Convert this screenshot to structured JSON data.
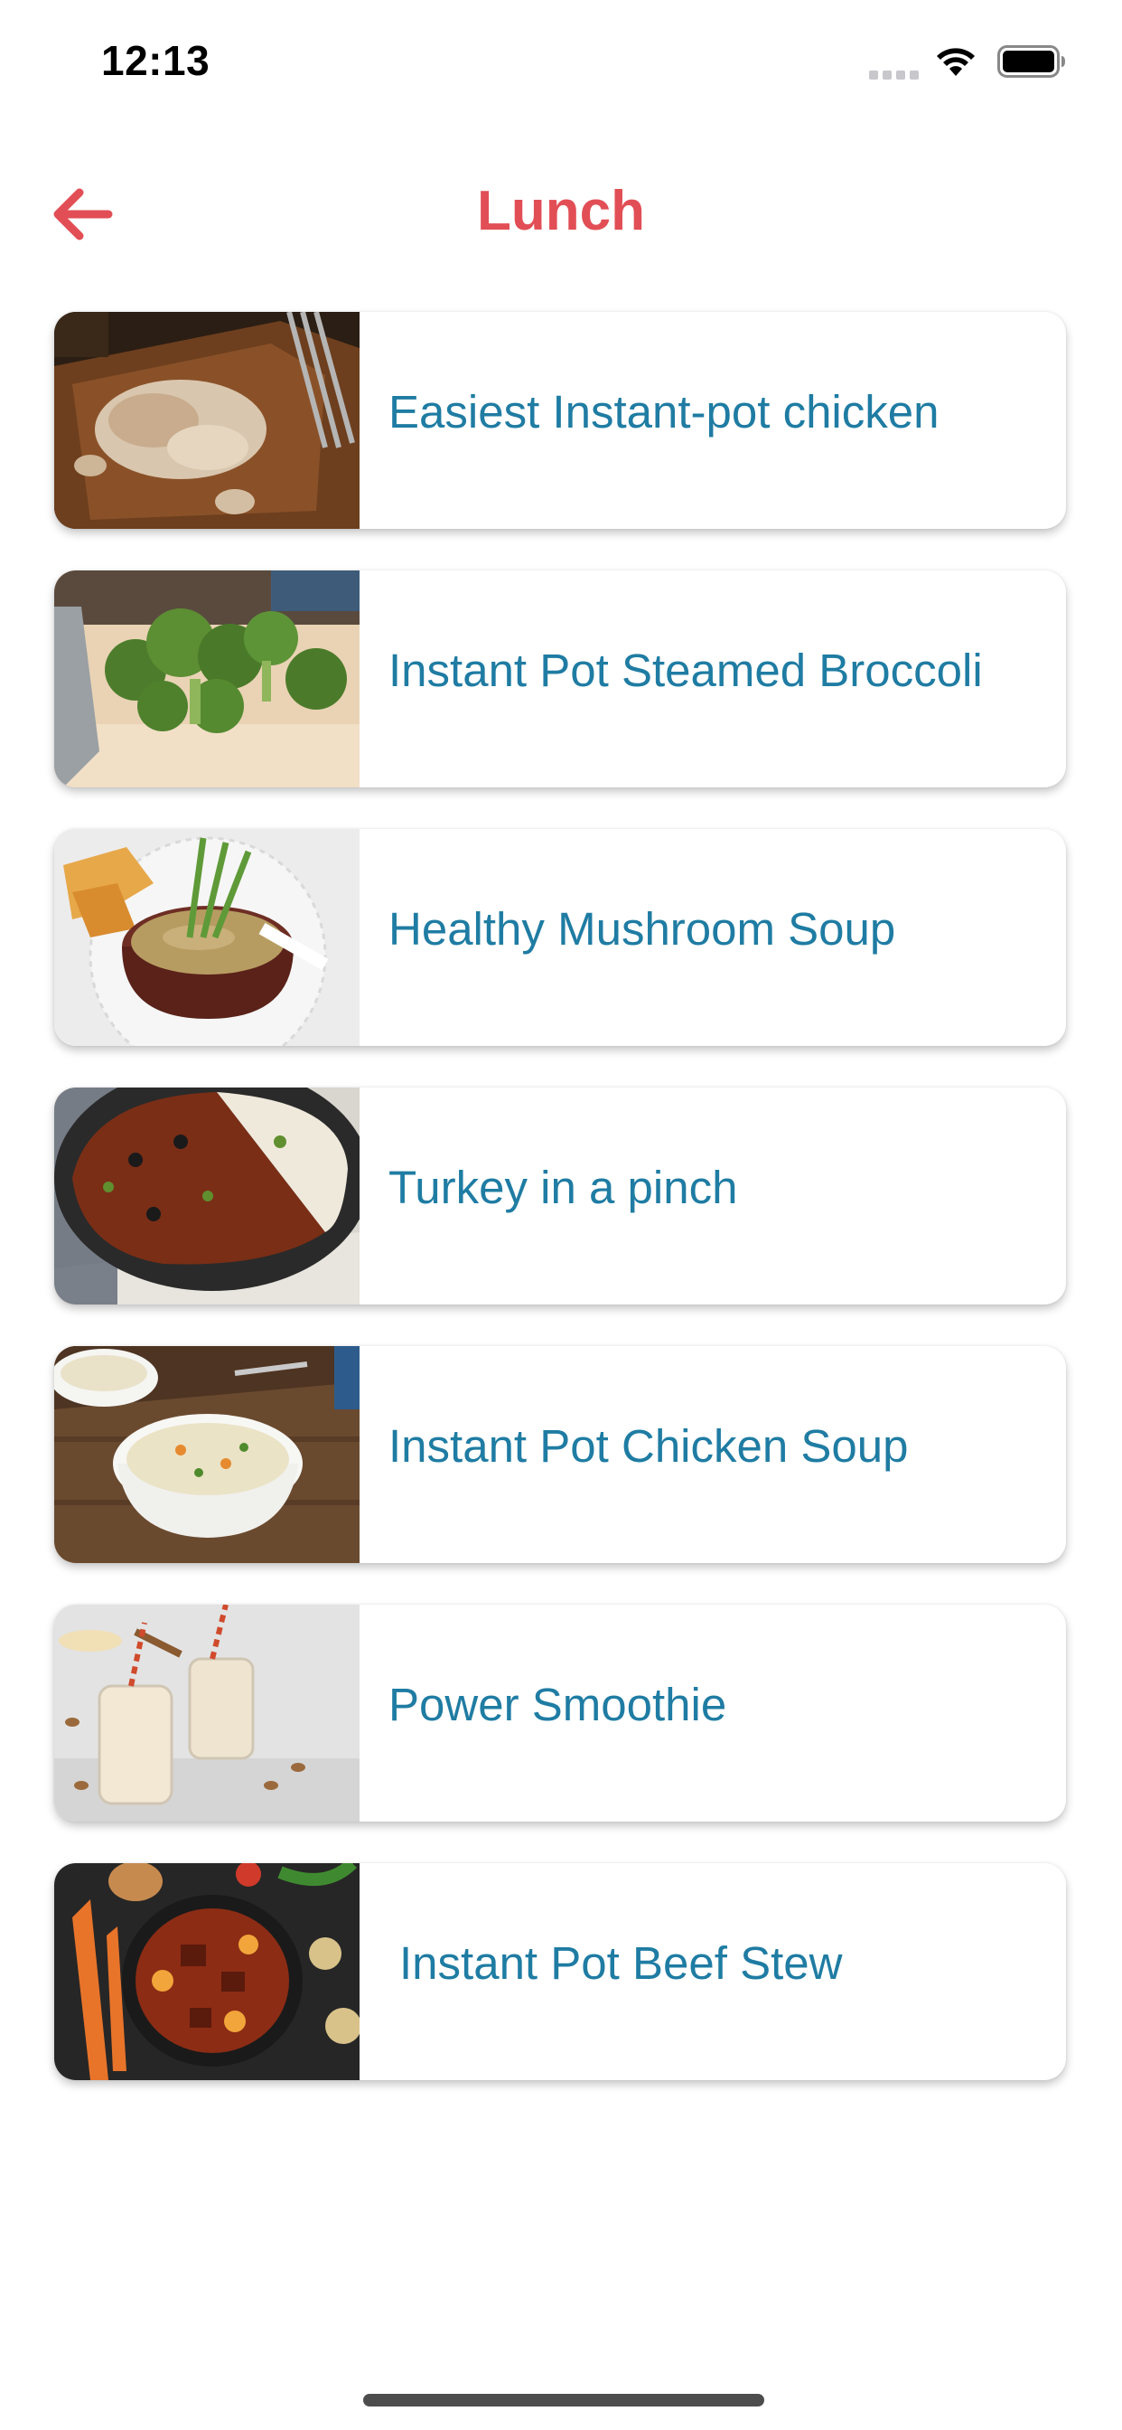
{
  "status_bar": {
    "time": "12:13"
  },
  "header": {
    "title": "Lunch",
    "back_icon": "arrow-left-icon"
  },
  "colors": {
    "accent": "#e24e55",
    "recipe_text": "#1f7ca3"
  },
  "recipes": [
    {
      "name": "Easiest Instant-pot chicken",
      "image": "shredded-chicken-on-board"
    },
    {
      "name": "Instant Pot Steamed Broccoli",
      "image": "broccoli-florets"
    },
    {
      "name": "Healthy Mushroom Soup",
      "image": "soup-in-bowl"
    },
    {
      "name": "Turkey in a pinch",
      "image": "ground-turkey-and-rice"
    },
    {
      "name": "Instant Pot Chicken Soup",
      "image": "chicken-vegetable-soup"
    },
    {
      "name": "Power Smoothie",
      "image": "smoothie-jars"
    },
    {
      "name": "Instant Pot Beef Stew",
      "image": "beef-stew-pan"
    }
  ]
}
